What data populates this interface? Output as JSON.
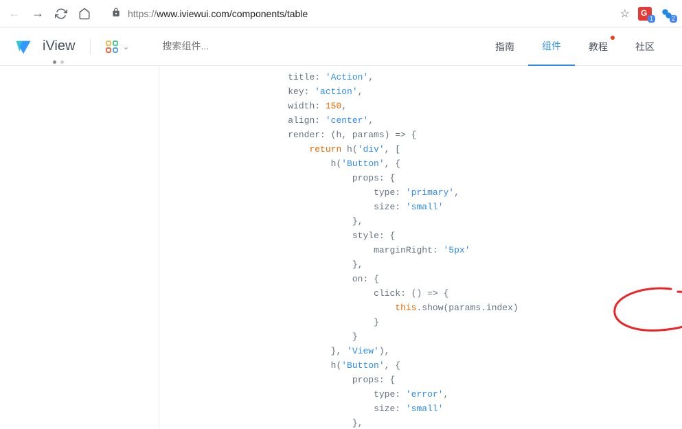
{
  "browser": {
    "url_prefix": "https://",
    "url": "www.iviewui.com/components/table",
    "ext_badges": [
      "1",
      "2"
    ]
  },
  "header": {
    "logo_text": "iView",
    "search_placeholder": "搜索组件...",
    "nav": [
      {
        "label": "指南",
        "active": false,
        "badge": false
      },
      {
        "label": "组件",
        "active": true,
        "badge": false
      },
      {
        "label": "教程",
        "active": false,
        "badge": true
      },
      {
        "label": "社区",
        "active": false,
        "badge": false
      }
    ]
  },
  "code": {
    "l1_a": "title: ",
    "l1_b": "'Action'",
    "l1_c": ",",
    "l2_a": "key: ",
    "l2_b": "'action'",
    "l2_c": ",",
    "l3_a": "width: ",
    "l3_b": "150",
    "l3_c": ",",
    "l4_a": "align: ",
    "l4_b": "'center'",
    "l4_c": ",",
    "l5": "render: (h, params) => {",
    "l6_a": "return",
    "l6_b": " h(",
    "l6_c": "'div'",
    "l6_d": ", [",
    "l7_a": "h(",
    "l7_b": "'Button'",
    "l7_c": ", {",
    "l8": "props: {",
    "l9_a": "type: ",
    "l9_b": "'primary'",
    "l9_c": ",",
    "l10_a": "size: ",
    "l10_b": "'small'",
    "l11": "},",
    "l12": "style: {",
    "l13_a": "marginRight: ",
    "l13_b": "'5px'",
    "l14": "},",
    "l15": "on: {",
    "l16": "click: () => {",
    "l17_a": "this",
    "l17_b": ".show(params.index)",
    "l18": "}",
    "l19": "}",
    "l20_a": "}, ",
    "l20_b": "'View'",
    "l20_c": "),",
    "l21_a": "h(",
    "l21_b": "'Button'",
    "l21_c": ", {",
    "l22": "props: {",
    "l23_a": "type: ",
    "l23_b": "'error'",
    "l23_c": ",",
    "l24_a": "size: ",
    "l24_b": "'small'",
    "l25": "},"
  },
  "indent": {
    "base": "                        ",
    "p1": "                            ",
    "p2": "                                ",
    "p3": "                                    ",
    "p4": "                                        ",
    "p5": "                                            ",
    "p6": "                                                "
  }
}
